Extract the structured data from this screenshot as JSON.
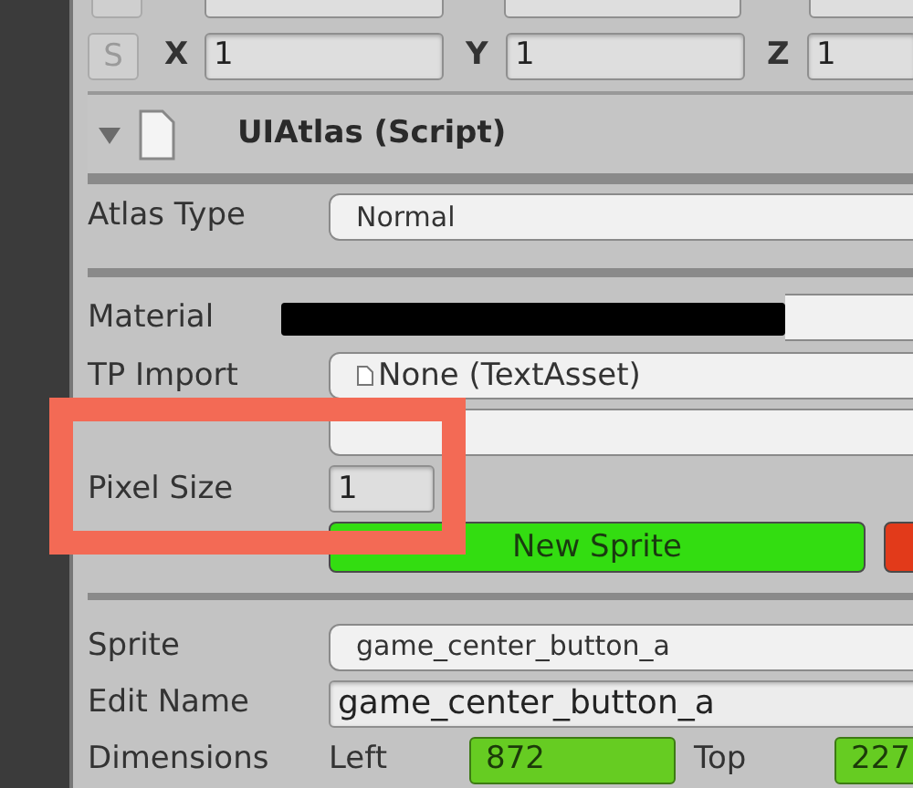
{
  "scale_row": {
    "button": "S",
    "fields": [
      {
        "axis": "X",
        "value": "1"
      },
      {
        "axis": "Y",
        "value": "1"
      },
      {
        "axis": "Z",
        "value": "1"
      }
    ]
  },
  "component": {
    "title": "UIAtlas (Script)",
    "expanded": true
  },
  "atlas_type": {
    "label": "Atlas Type",
    "value": "Normal"
  },
  "material": {
    "label": "Material",
    "redacted": true
  },
  "tp_import": {
    "label": "TP Import",
    "value": "None (TextAsset)"
  },
  "pixel_size": {
    "label": "Pixel Size",
    "value": "1"
  },
  "buttons": [
    {
      "label": "New Sprite",
      "color": "#33dd11"
    },
    {
      "color": "#e23a1a"
    }
  ],
  "sprite": {
    "label": "Sprite",
    "value": "game_center_button_a"
  },
  "edit_name": {
    "label": "Edit Name",
    "value": "game_center_button_a"
  },
  "dimensions": {
    "label": "Dimensions",
    "fields": [
      {
        "label": "Left",
        "value": "872"
      },
      {
        "label": "Top",
        "value": "227"
      }
    ]
  },
  "highlight_frame": true
}
